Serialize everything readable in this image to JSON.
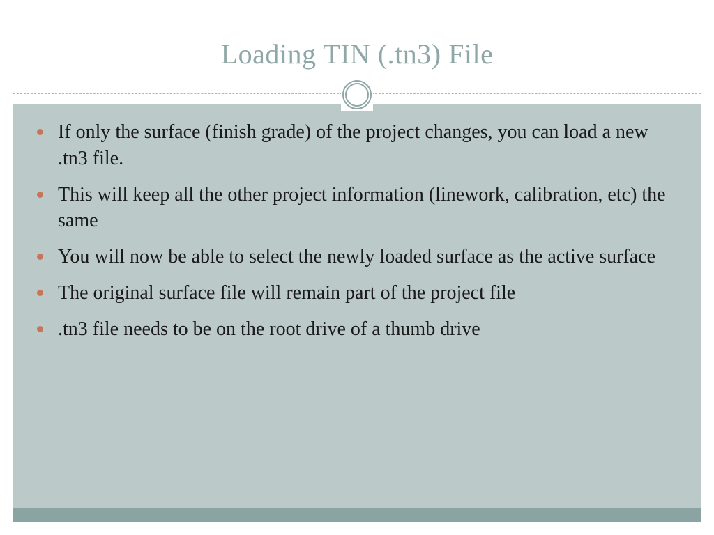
{
  "title": "Loading TIN (.tn3) File",
  "bullets": [
    "If only the surface (finish grade) of the project changes, you can load a new .tn3 file.",
    "This will keep all the other project information (linework, calibration, etc) the same",
    "You will now be able to select the newly loaded surface as the active surface",
    "The original surface file will remain part of the project file",
    ".tn3 file needs to be on the root drive of a thumb drive"
  ]
}
